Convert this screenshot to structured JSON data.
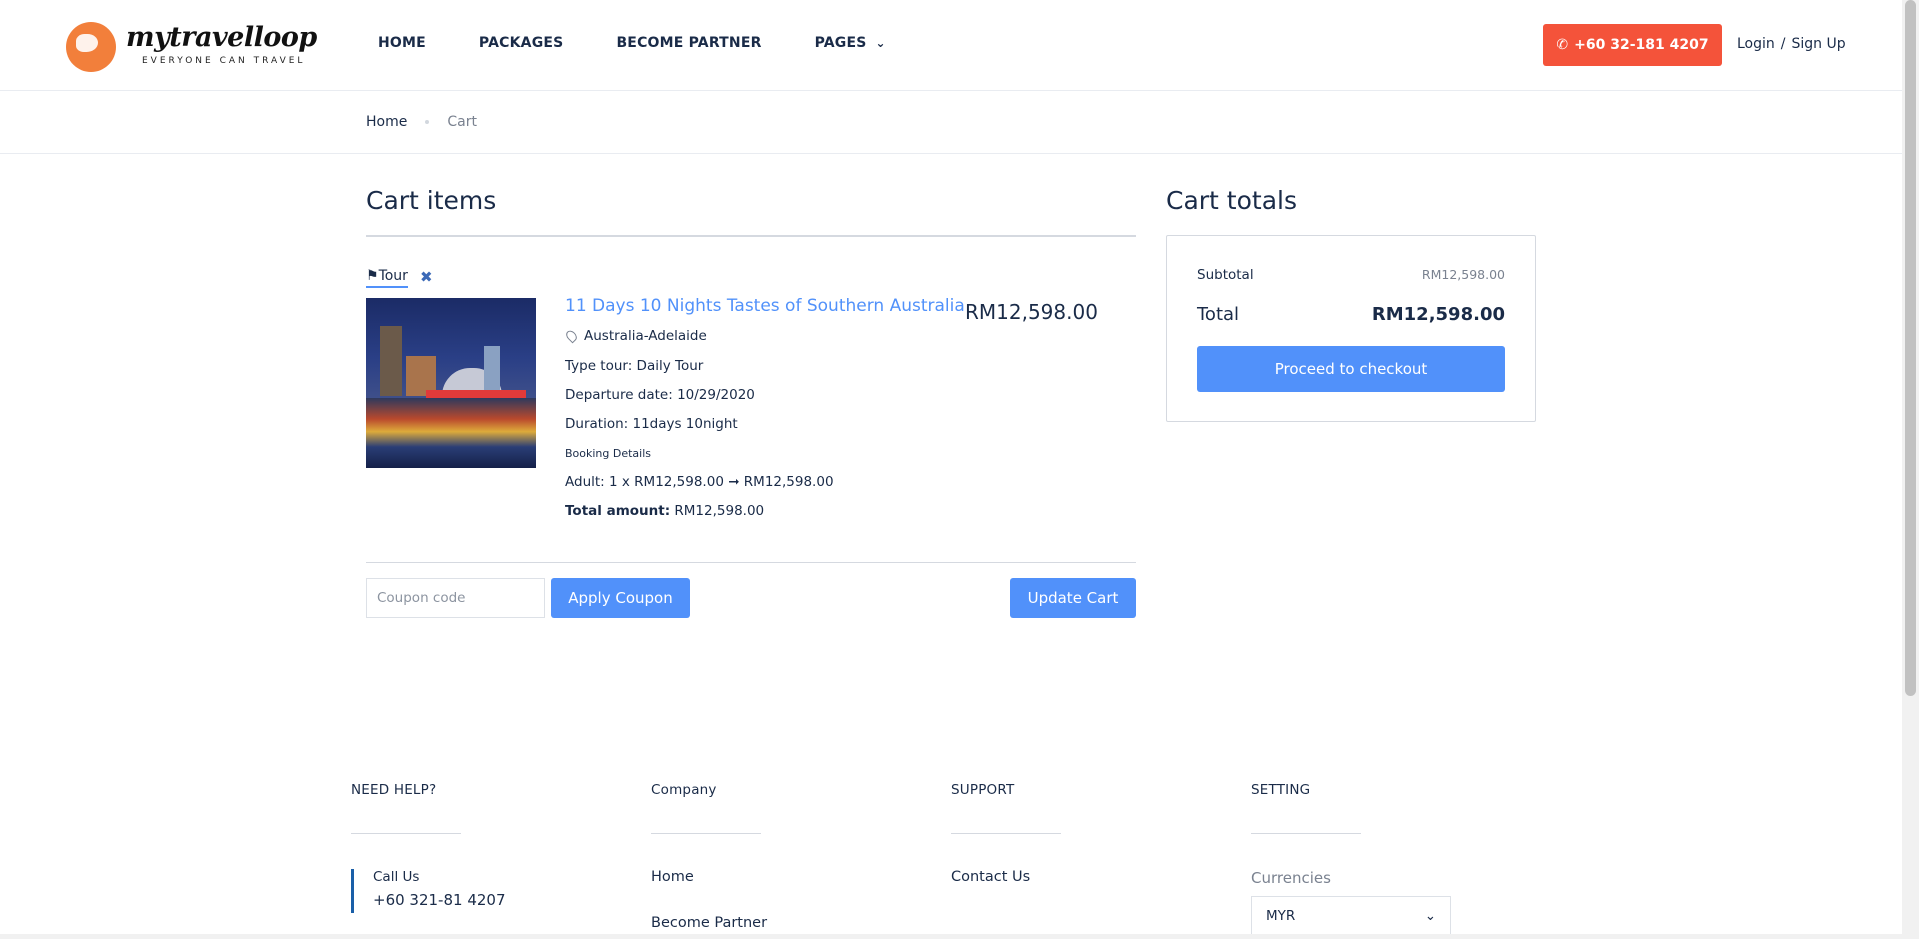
{
  "brand": {
    "name": "mytravelloop",
    "tagline": "EVERYONE CAN TRAVEL"
  },
  "nav": {
    "items": [
      {
        "label": "HOME"
      },
      {
        "label": "PACKAGES"
      },
      {
        "label": "BECOME PARTNER"
      },
      {
        "label": "PAGES"
      }
    ],
    "pages_chevron_icon": "chevron-down-icon"
  },
  "header": {
    "phone_label": "+60 32-181 4207",
    "phone_icon": "phone-icon",
    "login_label": "Login",
    "separator": "/",
    "signup_label": "Sign Up",
    "accent_color": "#f4533a"
  },
  "breadcrumb": {
    "home": "Home",
    "current": "Cart"
  },
  "cart": {
    "heading": "Cart items",
    "item": {
      "type_label": "Tour",
      "type_icon": "flag-icon",
      "remove_icon": "close-icon",
      "title": "11 Days 10 Nights Tastes of Southern Australia",
      "location": "Australia-Adelaide",
      "type_tour": "Type tour: Daily Tour",
      "departure": "Departure date: 10/29/2020",
      "duration": "Duration: 11days 10night",
      "booking_details_label": "Booking Details",
      "adult_line": "Adult: 1 x RM12,598.00 ➞ RM12,598.00",
      "total_amount_label": "Total amount:",
      "total_amount_value": "RM12,598.00",
      "price": "RM12,598.00"
    },
    "coupon_placeholder": "Coupon code",
    "apply_coupon_label": "Apply Coupon",
    "update_cart_label": "Update Cart",
    "accent_color": "#5191fa"
  },
  "totals": {
    "heading": "Cart totals",
    "subtotal_label": "Subtotal",
    "subtotal_value": "RM12,598.00",
    "total_label": "Total",
    "total_value": "RM12,598.00",
    "checkout_label": "Proceed to checkout"
  },
  "footer": {
    "need_help": {
      "heading": "NEED HELP?",
      "call_label": "Call Us",
      "call_number": "+60 321-81 4207"
    },
    "company": {
      "heading": "Company",
      "links": [
        "Home",
        "Become Partner"
      ]
    },
    "support": {
      "heading": "SUPPORT",
      "links": [
        "Contact Us"
      ]
    },
    "setting": {
      "heading": "SETTING",
      "currencies_label": "Currencies",
      "currency_value": "MYR"
    }
  }
}
